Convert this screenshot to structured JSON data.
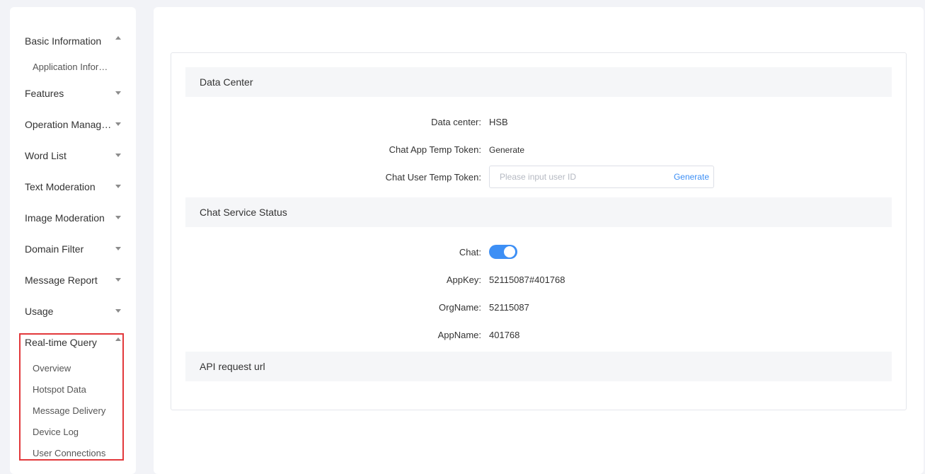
{
  "sidebar": {
    "groups": [
      {
        "label": "Basic Information",
        "expanded": true,
        "items": [
          "Application Information"
        ]
      },
      {
        "label": "Features",
        "expanded": false,
        "items": []
      },
      {
        "label": "Operation Management",
        "expanded": false,
        "items": []
      },
      {
        "label": "Word List",
        "expanded": false,
        "items": []
      },
      {
        "label": "Text Moderation",
        "expanded": false,
        "items": []
      },
      {
        "label": "Image Moderation",
        "expanded": false,
        "items": []
      },
      {
        "label": "Domain Filter",
        "expanded": false,
        "items": []
      },
      {
        "label": "Message Report",
        "expanded": false,
        "items": []
      },
      {
        "label": "Usage",
        "expanded": false,
        "items": []
      },
      {
        "label": "Real-time Query",
        "expanded": true,
        "items": [
          "Overview",
          "Hotspot Data",
          "Message Delivery",
          "Device Log",
          "User Connections"
        ]
      }
    ],
    "highlight_color": "#e2383b"
  },
  "main": {
    "data_center": {
      "title": "Data Center",
      "data_center_label": "Data center:",
      "data_center_value": "HSB",
      "app_token_label": "Chat App Temp Token:",
      "app_token_action": "Generate",
      "user_token_label": "Chat User Temp Token:",
      "user_token_placeholder": "Please input user ID",
      "user_token_value": "",
      "user_token_action": "Generate"
    },
    "service_status": {
      "title": "Chat Service Status",
      "chat_label": "Chat:",
      "chat_enabled": true,
      "appkey_label": "AppKey:",
      "appkey_value": "52115087#401768",
      "orgname_label": "OrgName:",
      "orgname_value": "52115087",
      "appname_label": "AppName:",
      "appname_value": "401768"
    },
    "api": {
      "title": "API request url"
    }
  },
  "colors": {
    "accent": "#3d8ff5",
    "section_bg": "#f5f6f8",
    "page_bg": "#f2f3f7"
  }
}
